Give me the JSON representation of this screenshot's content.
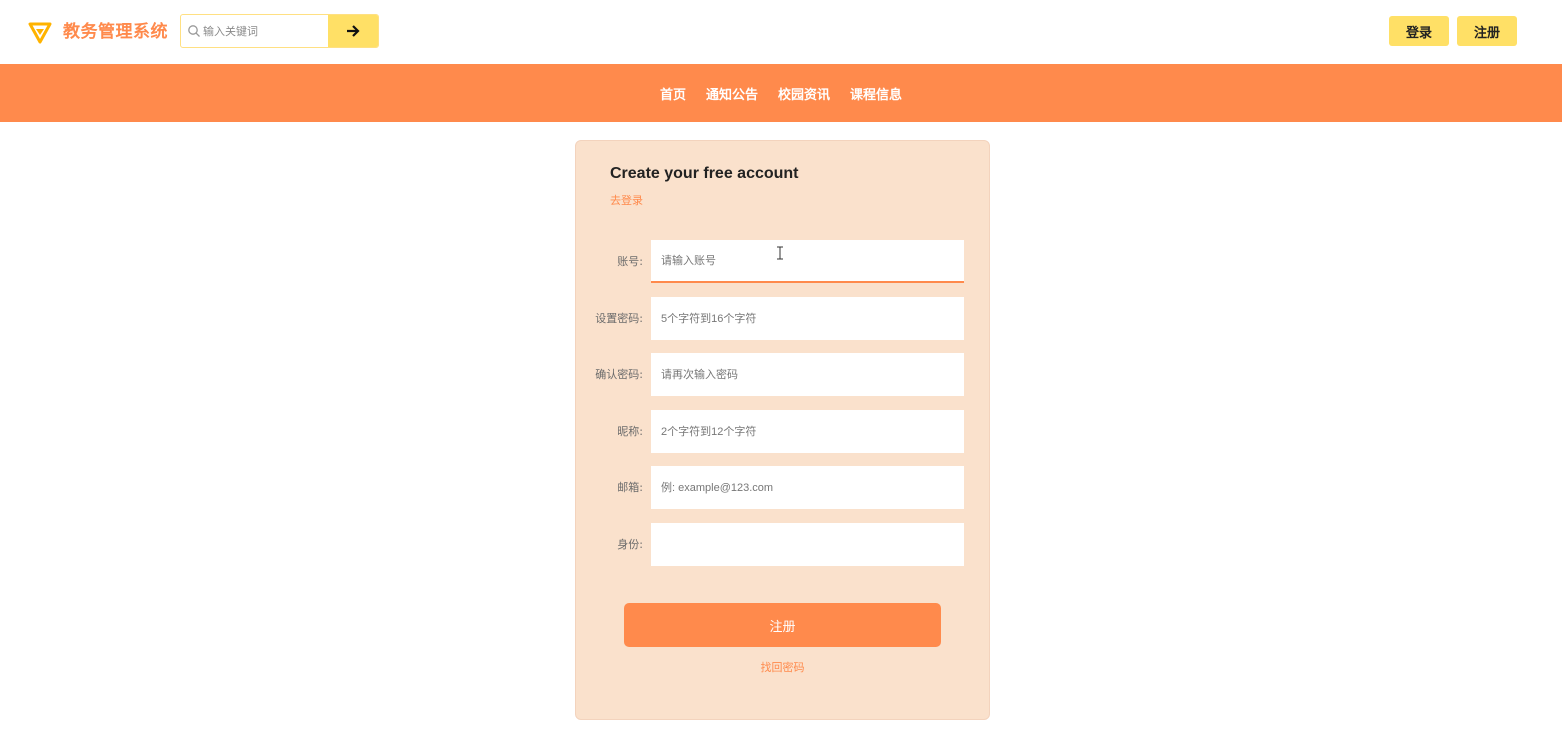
{
  "header": {
    "brand": "教务管理系统",
    "search_placeholder": "输入关键词",
    "login_label": "登录",
    "register_label": "注册",
    "accent": "#ffe066",
    "brand_color": "#ff8a4c"
  },
  "nav": {
    "items": [
      "首页",
      "通知公告",
      "校园资讯",
      "课程信息"
    ],
    "background": "#ff8a4c"
  },
  "form": {
    "title": "Create your free account",
    "goto_login": "去登录",
    "fields": [
      {
        "label": "账号:",
        "placeholder": "请输入账号"
      },
      {
        "label": "设置密码:",
        "placeholder": "5个字符到16个字符"
      },
      {
        "label": "确认密码:",
        "placeholder": "请再次输入密码"
      },
      {
        "label": "昵称:",
        "placeholder": "2个字符到12个字符"
      },
      {
        "label": "邮箱:",
        "placeholder": "例: example@123.com"
      },
      {
        "label": "身份:",
        "placeholder": ""
      }
    ],
    "submit_label": "注册",
    "forgot_password": "找回密码",
    "card_color": "#fae1cc"
  }
}
